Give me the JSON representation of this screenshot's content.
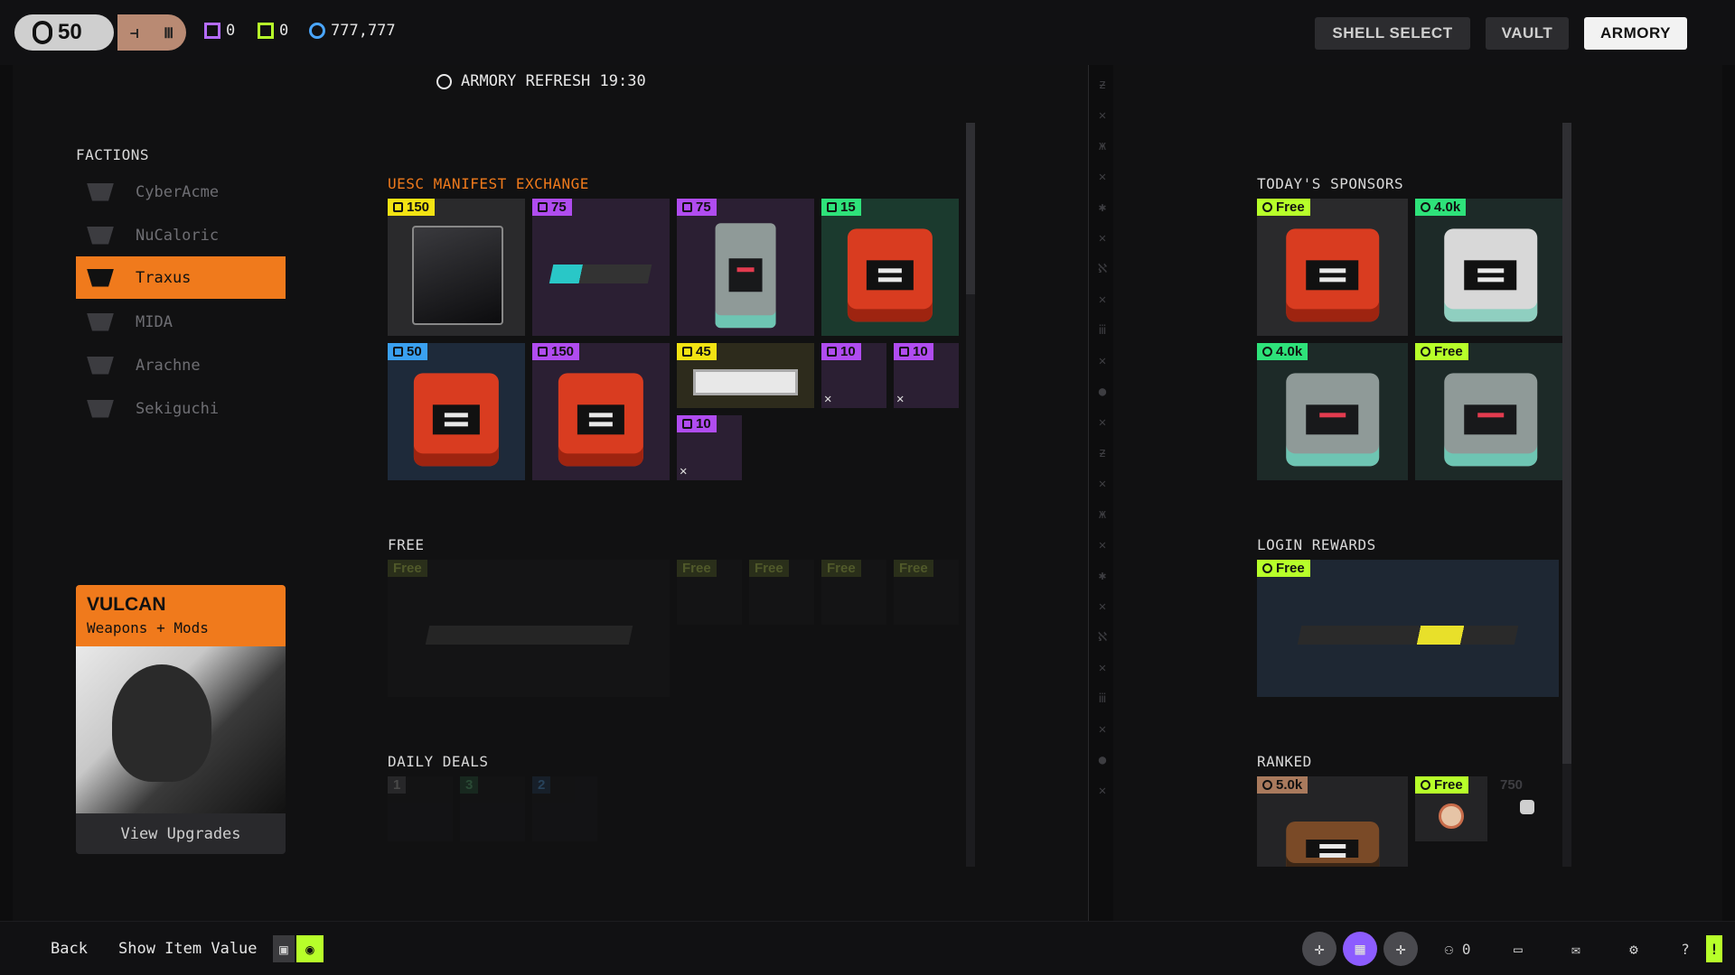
{
  "topbar": {
    "level": "50",
    "currency": [
      {
        "value": "0",
        "color": "#b56cff"
      },
      {
        "value": "0",
        "color": "#b7ff2a"
      },
      {
        "value": "777,777",
        "color": "#4aa6ff"
      }
    ],
    "nav": [
      "SHELL SELECT",
      "VAULT",
      "ARMORY"
    ],
    "active_nav": "ARMORY"
  },
  "refresh": "ARMORY REFRESH 19:30",
  "factions": {
    "title": "FACTIONS",
    "items": [
      "CyberAcme",
      "NuCaloric",
      "Traxus",
      "MIDA",
      "Arachne",
      "Sekiguchi"
    ],
    "active": "Traxus"
  },
  "upgrade_card": {
    "title": "VULCAN",
    "subtitle": "Weapons + Mods",
    "button": "View Upgrades"
  },
  "sections": {
    "exchange": "UESC MANIFEST EXCHANGE",
    "free": "FREE",
    "daily": "DAILY DEALS",
    "sponsors": "TODAY'S SPONSORS",
    "login": "LOGIN REWARDS",
    "ranked": "RANKED"
  },
  "exchange_tags": [
    "150",
    "75",
    "75",
    "15",
    "50",
    "150",
    "45",
    "10",
    "10",
    "10"
  ],
  "free_tags": [
    "Free",
    "Free",
    "Free",
    "Free",
    "Free"
  ],
  "daily_tags": [
    "1",
    "3",
    "2"
  ],
  "sponsor_tags": [
    "Free",
    "4.0k",
    "4.0k",
    "Free"
  ],
  "login_tag": "Free",
  "ranked_tags": [
    "5.0k",
    "Free",
    "750"
  ],
  "bottombar": {
    "back": "Back",
    "show_value": "Show Item Value",
    "friends_count": "0",
    "help": "?"
  },
  "colors": {
    "accent": "#f07a1c",
    "yellow": "#f2e313",
    "purple": "#b04cf0",
    "green": "#2ee27a",
    "blue": "#3aa0f0",
    "lime": "#b7ff2a",
    "bronze": "#a97a5d"
  }
}
